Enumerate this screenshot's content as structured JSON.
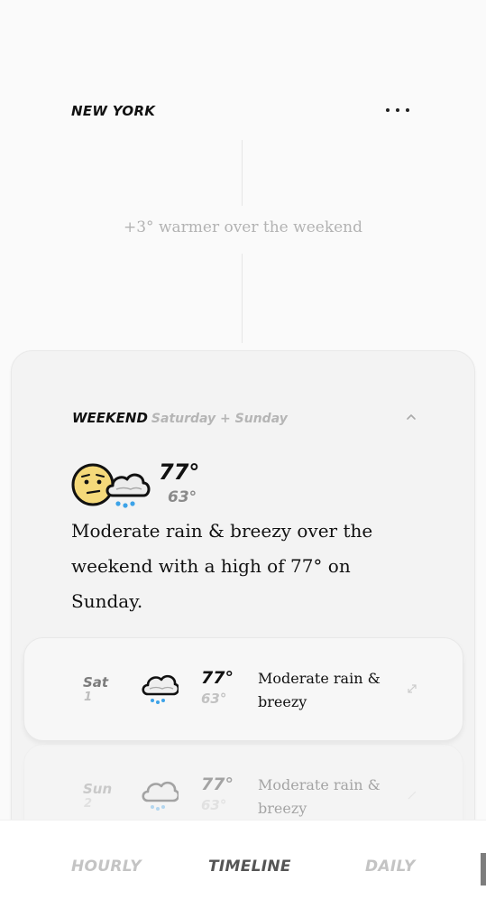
{
  "header": {
    "city": "NEW YORK",
    "more_icon": "more-dots-icon"
  },
  "summary": "+3° warmer over the weekend",
  "weekend": {
    "title": "WEEKEND",
    "days_label": "Saturday + Sunday",
    "high": "77°",
    "low": "63°",
    "description": "Moderate rain & breezy over the weekend with a high of 77° on Sunday.",
    "icons": [
      "worried-face-icon",
      "rain-cloud-icon"
    ]
  },
  "days": [
    {
      "name": "Sat",
      "num": "1",
      "high": "77°",
      "low": "63°",
      "text": "Moderate rain & breezy"
    },
    {
      "name": "Sun",
      "num": "2",
      "high": "77°",
      "low": "63°",
      "text": "Moderate rain & breezy"
    }
  ],
  "tabs": {
    "hourly": "HOURLY",
    "timeline": "TIMELINE",
    "daily": "DAILY"
  },
  "colors": {
    "background": "#fafafa",
    "card": "#f3f3f3",
    "rain_drop": "#3da3e8",
    "emoji_face": "#f5d97a"
  }
}
